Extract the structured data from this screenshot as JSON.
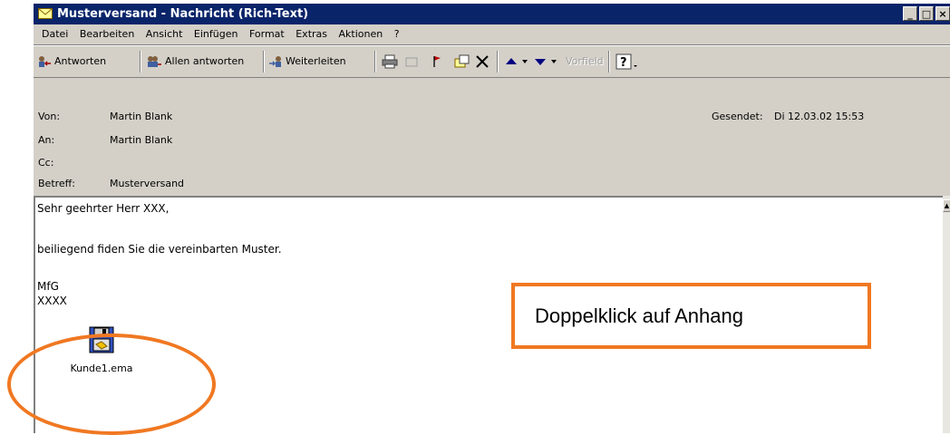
{
  "window": {
    "title": "Musterversand - Nachricht (Rich-Text)",
    "controls": [
      "_",
      "□",
      "×"
    ]
  },
  "menu": [
    "Datei",
    "Bearbeiten",
    "Ansicht",
    "Einfügen",
    "Format",
    "Extras",
    "Aktionen",
    "?"
  ],
  "toolbar": {
    "reply": "Antworten",
    "reply_all": "Allen antworten",
    "forward": "Weiterleiten",
    "previous_field": "Vorfield"
  },
  "header": {
    "from_label": "Von:",
    "from_value": "Martin Blank",
    "to_label": "An:",
    "to_value": "Martin Blank",
    "cc_label": "Cc:",
    "subject_label": "Betreff:",
    "subject_value": "Musterversand",
    "sent_label": "Gesendet:",
    "sent_value": "Di 12.03.02 15:53"
  },
  "body": {
    "line1": "Sehr geehrter Herr XXX,",
    "line2": "beiliegend fiden Sie die vereinbarten Muster.",
    "line3": "MfG",
    "line4": "XXXX"
  },
  "attachment": {
    "filename": "Kunde1.ema"
  },
  "callout": {
    "text": "Doppelklick auf Anhang"
  },
  "colors": {
    "titlebar": "#0a246a",
    "highlight": "#f07822",
    "chrome": "#d4d0c8"
  }
}
